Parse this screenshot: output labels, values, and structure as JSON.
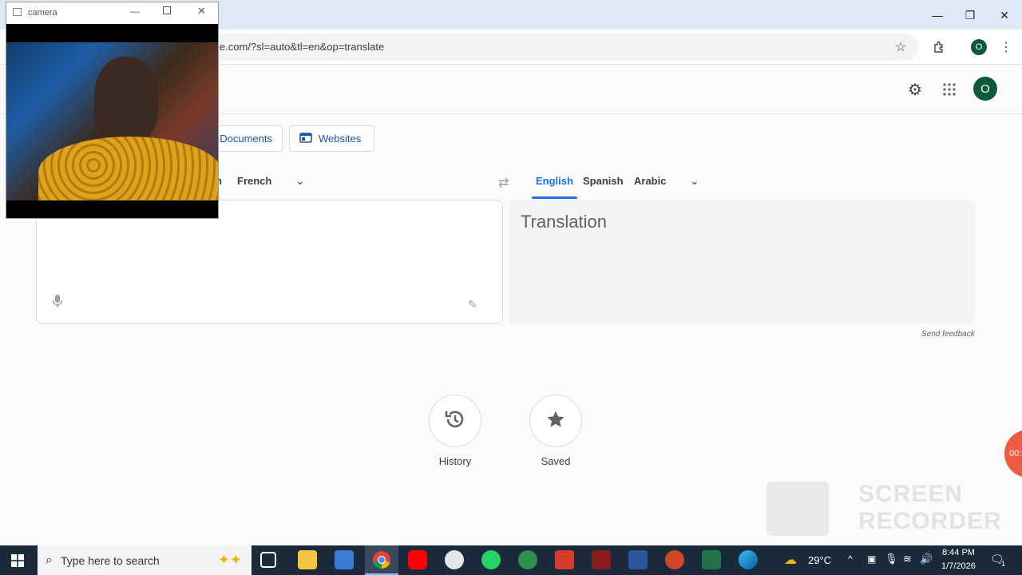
{
  "browser": {
    "url": "le.com/?sl=auto&tl=en&op=translate",
    "profile_initial": "O"
  },
  "header": {
    "profile_initial": "O"
  },
  "modes": {
    "documents": "Documents",
    "websites": "Websites"
  },
  "source_langs": {
    "partial": "h",
    "french": "French"
  },
  "target_langs": {
    "english": "English",
    "spanish": "Spanish",
    "arabic": "Arabic"
  },
  "output": {
    "placeholder": "Translation",
    "feedback": "Send feedback"
  },
  "actions": {
    "history": "History",
    "saved": "Saved"
  },
  "camera": {
    "title": "camera"
  },
  "recorder": {
    "timer": "00:",
    "line1": "SCREEN",
    "line2": "RECORDER"
  },
  "taskbar": {
    "search_placeholder": "Type here to search",
    "weather": "29°C",
    "time": "8:44 PM",
    "date": "1/7/2026",
    "notification_count": "1"
  },
  "colors": {
    "accent": "#1a73e8",
    "avatar": "#0b5a3a",
    "taskbar": "#1b2a3b"
  }
}
